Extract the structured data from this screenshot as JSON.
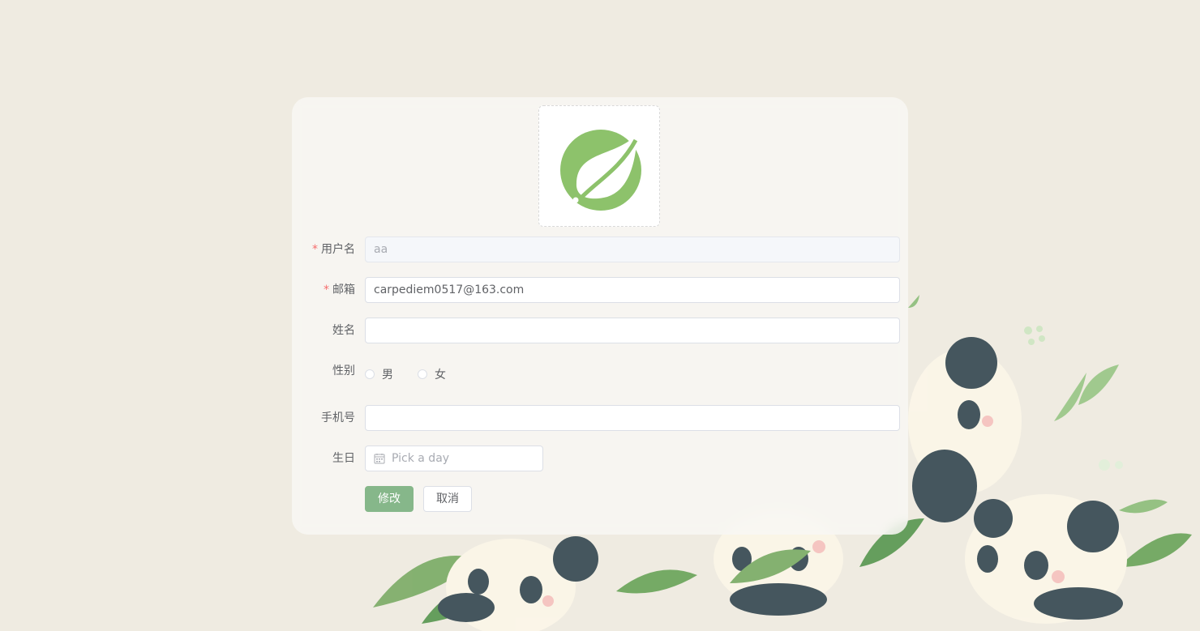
{
  "form": {
    "username": {
      "label": "用户名",
      "required": true,
      "value": "aa",
      "disabled": true
    },
    "email": {
      "label": "邮箱",
      "required": true,
      "value": "carpediem0517@163.com"
    },
    "name": {
      "label": "姓名",
      "value": ""
    },
    "gender": {
      "label": "性别",
      "options": [
        "男",
        "女"
      ],
      "selected": null
    },
    "phone": {
      "label": "手机号",
      "value": ""
    },
    "birthday": {
      "label": "生日",
      "placeholder": "Pick a day"
    }
  },
  "buttons": {
    "submit": "修改",
    "cancel": "取消"
  },
  "required_mark": "*",
  "avatar": {
    "icon": "spring-leaf-logo-icon",
    "color": "#8dc26b"
  },
  "colors": {
    "primary_button": "#86b78a",
    "required": "#f56c6c",
    "background": "#efebe1"
  }
}
